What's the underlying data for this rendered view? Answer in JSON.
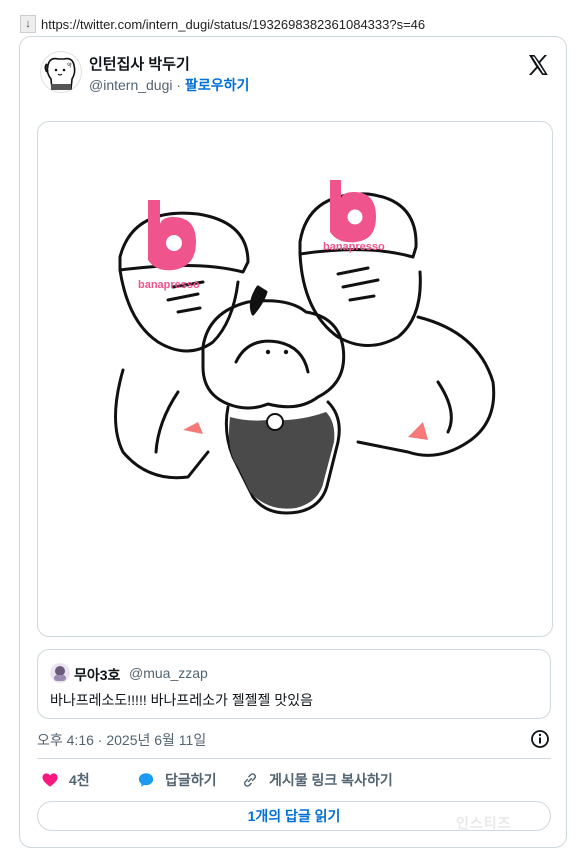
{
  "browser": {
    "url": "https://twitter.com/intern_dugi/status/1932698382361084333?s=46",
    "download_icon": "arrow-down-icon"
  },
  "tweet": {
    "display_name": "인턴집사 박두기",
    "handle": "@intern_dugi",
    "separator": " · ",
    "follow_label": "팔로우하기",
    "brand_icon": "x-logo-icon",
    "media_logo_text": "banapresso",
    "timestamp": "오후 4:16 · 2025년 6월 11일",
    "likes": "4천",
    "reply_label": "답글하기",
    "copy_link_label": "게시물 링크 복사하기",
    "read_replies_label": "1개의 답글 읽기"
  },
  "quote": {
    "name": "무아3호",
    "handle": "@mua_zzap",
    "text": "바나프레소도!!!!! 바나프레소가 젤젤젤 맛있음"
  },
  "watermark": "인스티즈",
  "colors": {
    "like": "#f91880",
    "reply": "#1d9bf0",
    "follow": "#006fd6",
    "brand_pink": "#f0548c",
    "border": "#cfd9de"
  }
}
